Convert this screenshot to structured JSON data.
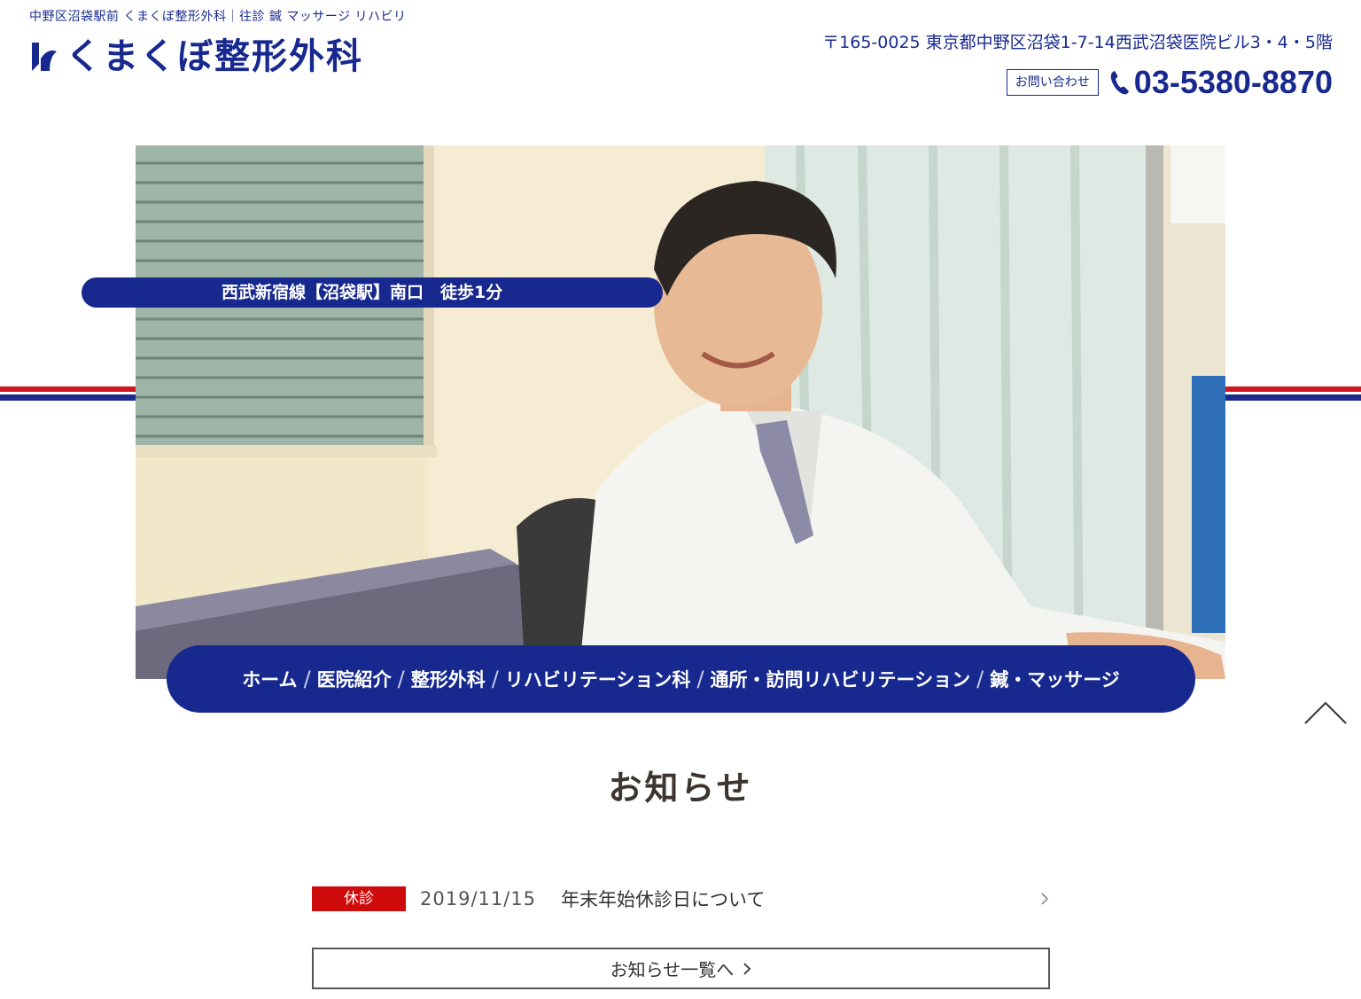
{
  "header": {
    "tagline": "中野区沼袋駅前 くまくぼ整形外科｜往診 鍼 マッサージ リハビリ",
    "logo_text": "くまくぼ整形外科",
    "address": "〒165-0025 東京都中野区沼袋1-7-14西武沼袋医院ビル3・4・5階",
    "contact_label": "お問い合わせ",
    "phone": "03-5380-8870"
  },
  "hero": {
    "access_text": "西武新宿線【沼袋駅】南口　徒歩1分"
  },
  "nav": {
    "items": [
      {
        "label": "ホーム"
      },
      {
        "label": "医院紹介"
      },
      {
        "label": "整形外科"
      },
      {
        "label": "リハビリテーション科"
      },
      {
        "label": "通所・訪問リハビリテーション"
      },
      {
        "label": "鍼・マッサージ"
      }
    ],
    "separator": "/"
  },
  "news": {
    "title": "お知らせ",
    "items": [
      {
        "badge": "休診",
        "date": "2019/11/15",
        "title": "年末年始休診日について"
      }
    ],
    "more_label": "お知らせ一覧へ"
  },
  "colors": {
    "brand_blue": "#17298f",
    "brand_red": "#d0161e",
    "badge_red": "#cf0a0a"
  },
  "icons": {
    "phone": "phone-icon",
    "chevron": "chevron-right-icon",
    "to_top": "chevron-up-icon"
  }
}
